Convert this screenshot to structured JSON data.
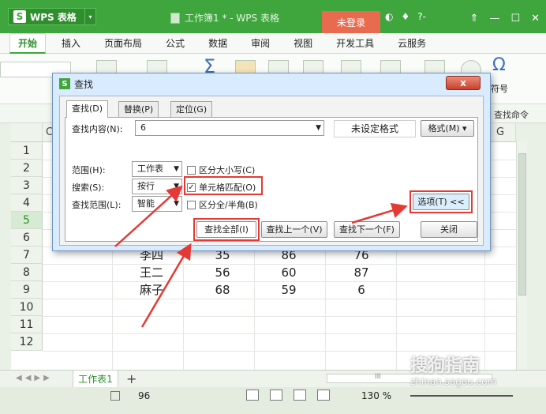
{
  "titlebar": {
    "app_name": "WPS 表格",
    "doc_title": "工作簿1 * - WPS 表格",
    "login": "未登录",
    "icons": [
      "skin-icon",
      "shirt-icon",
      "help-icon"
    ],
    "help_text": "?-",
    "window_controls": [
      "restore-icon",
      "minimize-icon",
      "maximize-icon",
      "close-icon"
    ]
  },
  "ribbon": {
    "tabs": [
      "开始",
      "插入",
      "页面布局",
      "公式",
      "数据",
      "审阅",
      "视图",
      "开发工具",
      "云服务"
    ],
    "symbol_label": "符号",
    "find_command": "查找命令"
  },
  "grid": {
    "partial_col_label": "C",
    "col_g": "G",
    "rows": [
      "1",
      "2",
      "3",
      "4",
      "5",
      "6",
      "7",
      "8",
      "9",
      "10",
      "11",
      "12"
    ],
    "data_rows": [
      {
        "name": "李四",
        "b": "35",
        "c": "86",
        "d": "76"
      },
      {
        "name": "王二",
        "b": "56",
        "c": "60",
        "d": "87"
      },
      {
        "name": "麻子",
        "b": "68",
        "c": "59",
        "d": "6"
      }
    ]
  },
  "sheet": {
    "tab_label": "工作表1",
    "plus": "+",
    "status_value": "96",
    "zoom": "130 %",
    "hscroll_mark": "III"
  },
  "dialog": {
    "title": "查找",
    "close_label": "x",
    "tabs": [
      "查找(D)",
      "替换(P)",
      "定位(G)"
    ],
    "find_label": "查找内容(N):",
    "find_value": "6",
    "format_status": "未设定格式",
    "format_button": "格式(M)",
    "range_label": "范围(H):",
    "range_value": "工作表",
    "search_label": "搜索(S):",
    "search_value": "按行",
    "lookin_label": "查找范围(L):",
    "lookin_value": "智能",
    "options": {
      "match_case": {
        "label": "区分大小写(C)",
        "checked": false
      },
      "match_cell": {
        "label": "单元格匹配(O)",
        "checked": true
      },
      "match_width": {
        "label": "区分全/半角(B)",
        "checked": false
      }
    },
    "options_button": "选项(T) <<",
    "buttons": {
      "find_all": "查找全部(I)",
      "find_prev": "查找上一个(V)",
      "find_next": "查找下一个(F)",
      "close": "关闭"
    }
  },
  "watermark": {
    "brand": "搜狗指南",
    "url": "zhinan.sogou.com"
  },
  "colors": {
    "accent_green": "#3fa63d",
    "annotation_red": "#e53935",
    "dialog_blue": "#d9ecff"
  }
}
